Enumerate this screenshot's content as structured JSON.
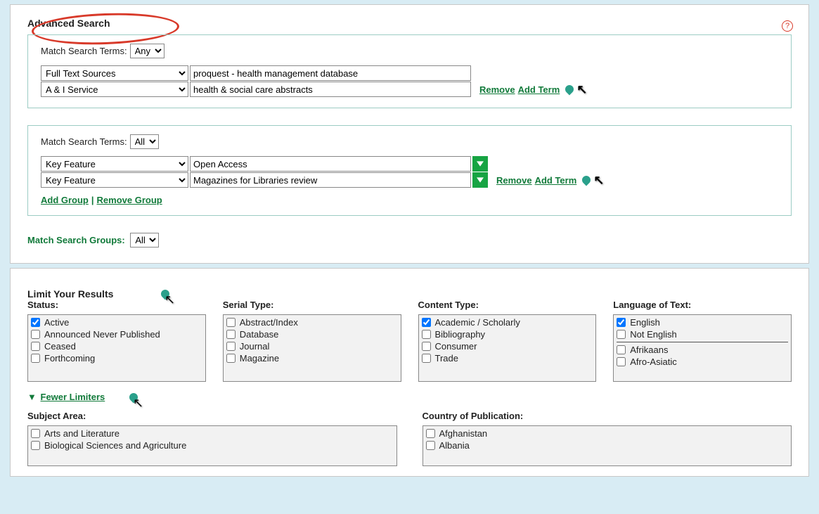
{
  "header": {
    "title": "Advanced Search",
    "help_glyph": "?"
  },
  "match_labels": {
    "search_terms": "Match Search Terms:",
    "search_groups": "Match Search Groups:"
  },
  "groups": [
    {
      "match_value": "Any",
      "rows": [
        {
          "field": "Full Text Sources",
          "value": "proquest - health management database",
          "has_dropdown": false
        },
        {
          "field": "A & I Service",
          "value": "health & social care abstracts",
          "has_dropdown": false
        }
      ],
      "show_group_actions": false
    },
    {
      "match_value": "All",
      "rows": [
        {
          "field": "Key Feature",
          "value": "Open Access",
          "has_dropdown": true
        },
        {
          "field": "Key Feature",
          "value": "Magazines for Libraries review",
          "has_dropdown": true
        }
      ],
      "show_group_actions": true
    }
  ],
  "row_action_labels": {
    "remove": "Remove",
    "add_term": "Add Term"
  },
  "group_action_labels": {
    "add_group": "Add Group",
    "remove_group": "Remove Group"
  },
  "match_groups_value": "All",
  "limits": {
    "title": "Limit Your Results",
    "status": {
      "label": "Status:",
      "items": [
        {
          "label": "Active",
          "checked": true
        },
        {
          "label": "Announced Never Published",
          "checked": false
        },
        {
          "label": "Ceased",
          "checked": false
        },
        {
          "label": "Forthcoming",
          "checked": false
        }
      ]
    },
    "serial_type": {
      "label": "Serial Type:",
      "items": [
        {
          "label": "Abstract/Index",
          "checked": false
        },
        {
          "label": "Database",
          "checked": false
        },
        {
          "label": "Journal",
          "checked": false
        },
        {
          "label": "Magazine",
          "checked": false
        }
      ]
    },
    "content_type": {
      "label": "Content Type:",
      "items": [
        {
          "label": "Academic / Scholarly",
          "checked": true
        },
        {
          "label": "Bibliography",
          "checked": false
        },
        {
          "label": "Consumer",
          "checked": false
        },
        {
          "label": "Trade",
          "checked": false
        }
      ]
    },
    "language": {
      "label": "Language of Text:",
      "items": [
        {
          "label": "English",
          "checked": true
        },
        {
          "label": "Not English",
          "checked": false
        },
        {
          "label": "Afrikaans",
          "checked": false
        },
        {
          "label": "Afro-Asiatic",
          "checked": false
        }
      ]
    },
    "fewer_label": "Fewer Limiters",
    "subject_area": {
      "label": "Subject Area:",
      "items": [
        {
          "label": "Arts and Literature",
          "checked": false
        },
        {
          "label": "Biological Sciences and Agriculture",
          "checked": false
        }
      ]
    },
    "country": {
      "label": "Country of Publication:",
      "items": [
        {
          "label": "Afghanistan",
          "checked": false
        },
        {
          "label": "Albania",
          "checked": false
        }
      ]
    }
  }
}
